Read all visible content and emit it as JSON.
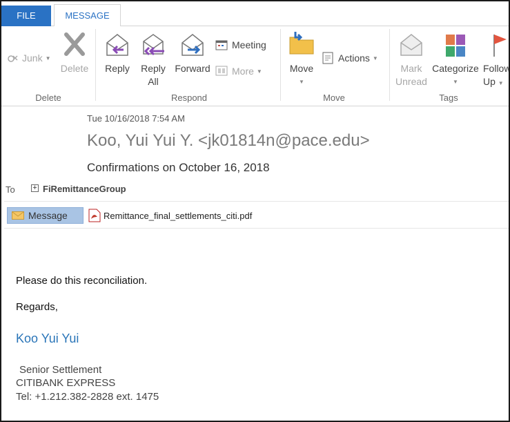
{
  "tabs": {
    "file": "FILE",
    "message": "MESSAGE"
  },
  "ribbon": {
    "delete_group": {
      "label": "Delete",
      "junk": "Junk",
      "delete": "Delete"
    },
    "respond_group": {
      "label": "Respond",
      "reply": "Reply",
      "reply_all_1": "Reply",
      "reply_all_2": "All",
      "forward": "Forward",
      "meeting": "Meeting",
      "more": "More"
    },
    "move_group": {
      "label": "Move",
      "move": "Move",
      "actions": "Actions"
    },
    "tags_group": {
      "label": "Tags",
      "mark_unread_1": "Mark",
      "mark_unread_2": "Unread",
      "categorize": "Categorize",
      "follow_up_1": "Follow",
      "follow_up_2": "Up"
    }
  },
  "email": {
    "date": "Tue 10/16/2018 7:54 AM",
    "sender": "Koo, Yui Yui Y. <jk01814n@pace.edu>",
    "subject": "Confirmations on October 16, 2018",
    "to_label": "To",
    "to_value": "FiRemittanceGroup",
    "message_tab": "Message",
    "attachment": "Remittance_final_settlements_citi.pdf",
    "body": {
      "line1": "Please do this reconciliation.",
      "line2": "Regards,"
    },
    "signature": {
      "name": "Koo Yui Yui",
      "title": "Senior Settlement",
      "company": "CITIBANK EXPRESS",
      "tel": "Tel: +1.212.382-2828 ext. 1475"
    }
  },
  "colors": {
    "accent": "#2a72c4",
    "signature": "#2a75b8",
    "message_tab": "#a9c4e4"
  }
}
